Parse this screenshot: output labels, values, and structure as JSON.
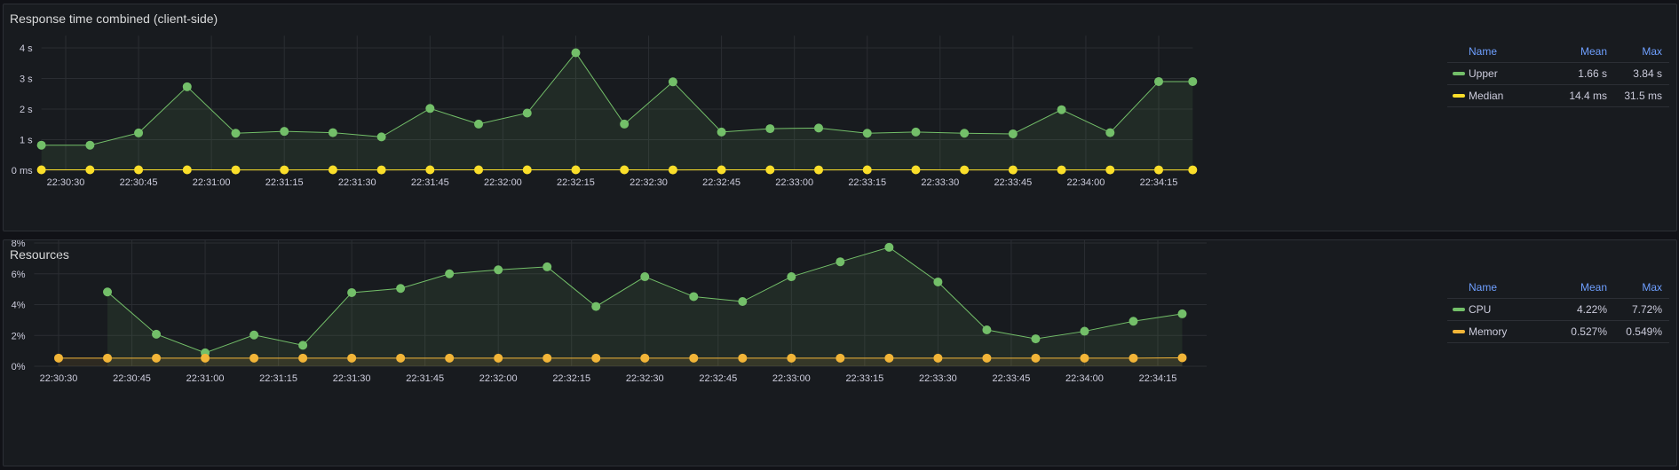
{
  "panels": [
    {
      "title": "Response time combined (client-side)",
      "legend": {
        "headers": {
          "name": "Name",
          "mean": "Mean",
          "max": "Max"
        },
        "rows": [
          {
            "name": "Upper",
            "mean": "1.66 s",
            "max": "3.84 s",
            "color": "#73bf69"
          },
          {
            "name": "Median",
            "mean": "14.4 ms",
            "max": "31.5 ms",
            "color": "#fade2a"
          }
        ]
      }
    },
    {
      "title": "Resources",
      "legend": {
        "headers": {
          "name": "Name",
          "mean": "Mean",
          "max": "Max"
        },
        "rows": [
          {
            "name": "CPU",
            "mean": "4.22%",
            "max": "7.72%",
            "color": "#73bf69"
          },
          {
            "name": "Memory",
            "mean": "0.527%",
            "max": "0.549%",
            "color": "#f2b538"
          }
        ]
      }
    }
  ],
  "chart_data": [
    {
      "type": "line",
      "title": "Response time combined (client-side)",
      "y_unit": "s",
      "ylim": [
        0,
        4.4
      ],
      "y_ticks": [
        0,
        1,
        2,
        3,
        4
      ],
      "y_tick_labels": [
        "0 ms",
        "1 s",
        "2 s",
        "3 s",
        "4 s"
      ],
      "x_range": [
        "22:30:25",
        "22:34:22"
      ],
      "x_ticks": [
        "22:30:30",
        "22:30:45",
        "22:31:00",
        "22:31:15",
        "22:31:30",
        "22:31:45",
        "22:32:00",
        "22:32:15",
        "22:32:30",
        "22:32:45",
        "22:33:00",
        "22:33:15",
        "22:33:30",
        "22:33:45",
        "22:34:00",
        "22:34:15"
      ],
      "grid": true,
      "fill": true,
      "legend_placement": "right",
      "series": [
        {
          "name": "Upper",
          "color": "#73bf69",
          "x": [
            "22:30:25",
            "22:30:35",
            "22:30:45",
            "22:30:55",
            "22:31:05",
            "22:31:15",
            "22:31:25",
            "22:31:35",
            "22:31:45",
            "22:31:55",
            "22:32:05",
            "22:32:15",
            "22:32:25",
            "22:32:35",
            "22:32:45",
            "22:32:55",
            "22:33:05",
            "22:33:15",
            "22:33:25",
            "22:33:35",
            "22:33:45",
            "22:33:55",
            "22:34:05",
            "22:34:15",
            "22:34:22"
          ],
          "values": [
            0.82,
            0.82,
            1.22,
            2.73,
            1.21,
            1.27,
            1.23,
            1.09,
            2.02,
            1.51,
            1.87,
            3.84,
            1.51,
            2.89,
            1.25,
            1.36,
            1.38,
            1.21,
            1.25,
            1.21,
            1.19,
            1.98,
            1.23,
            2.9,
            2.9
          ]
        },
        {
          "name": "Median",
          "color": "#fade2a",
          "x": [
            "22:30:25",
            "22:30:35",
            "22:30:45",
            "22:30:55",
            "22:31:05",
            "22:31:15",
            "22:31:25",
            "22:31:35",
            "22:31:45",
            "22:31:55",
            "22:32:05",
            "22:32:15",
            "22:32:25",
            "22:32:35",
            "22:32:45",
            "22:32:55",
            "22:33:05",
            "22:33:15",
            "22:33:25",
            "22:33:35",
            "22:33:45",
            "22:33:55",
            "22:34:05",
            "22:34:15",
            "22:34:22"
          ],
          "values": [
            0.015,
            0.015,
            0.015,
            0.015,
            0.012,
            0.012,
            0.015,
            0.012,
            0.015,
            0.015,
            0.015,
            0.015,
            0.015,
            0.012,
            0.015,
            0.015,
            0.012,
            0.015,
            0.015,
            0.012,
            0.012,
            0.012,
            0.012,
            0.012,
            0.012
          ]
        }
      ]
    },
    {
      "type": "line",
      "title": "Resources",
      "y_unit": "%",
      "ylim": [
        0,
        8.6
      ],
      "y_ticks": [
        0,
        2,
        4,
        6,
        8
      ],
      "y_tick_labels": [
        "0%",
        "2%",
        "4%",
        "6%",
        "8%"
      ],
      "x_range": [
        "22:30:25",
        "22:34:25"
      ],
      "x_ticks": [
        "22:30:30",
        "22:30:45",
        "22:31:00",
        "22:31:15",
        "22:31:30",
        "22:31:45",
        "22:32:00",
        "22:32:15",
        "22:32:30",
        "22:32:45",
        "22:33:00",
        "22:33:15",
        "22:33:30",
        "22:33:45",
        "22:34:00",
        "22:34:15"
      ],
      "grid": true,
      "fill": true,
      "legend_placement": "right",
      "series": [
        {
          "name": "CPU",
          "color": "#73bf69",
          "x": [
            "22:30:40",
            "22:30:50",
            "22:31:00",
            "22:31:10",
            "22:31:20",
            "22:31:30",
            "22:31:40",
            "22:31:50",
            "22:32:00",
            "22:32:10",
            "22:32:20",
            "22:32:30",
            "22:32:40",
            "22:32:50",
            "22:33:00",
            "22:33:10",
            "22:33:20",
            "22:33:30",
            "22:33:40",
            "22:33:50",
            "22:34:00",
            "22:34:10",
            "22:34:20"
          ],
          "values": [
            4.82,
            2.08,
            0.87,
            2.03,
            1.36,
            4.78,
            5.05,
            6.0,
            6.26,
            6.45,
            3.88,
            5.81,
            4.52,
            4.2,
            5.81,
            6.78,
            7.72,
            5.47,
            2.36,
            1.78,
            2.27,
            2.92,
            3.4
          ]
        },
        {
          "name": "Memory",
          "color": "#f2b538",
          "x": [
            "22:30:30",
            "22:30:40",
            "22:30:50",
            "22:31:00",
            "22:31:10",
            "22:31:20",
            "22:31:30",
            "22:31:40",
            "22:31:50",
            "22:32:00",
            "22:32:10",
            "22:32:20",
            "22:32:30",
            "22:32:40",
            "22:32:50",
            "22:33:00",
            "22:33:10",
            "22:33:20",
            "22:33:30",
            "22:33:40",
            "22:33:50",
            "22:34:00",
            "22:34:10",
            "22:34:20"
          ],
          "values": [
            0.527,
            0.527,
            0.527,
            0.527,
            0.527,
            0.527,
            0.527,
            0.527,
            0.527,
            0.527,
            0.527,
            0.527,
            0.527,
            0.527,
            0.527,
            0.527,
            0.527,
            0.527,
            0.527,
            0.527,
            0.527,
            0.527,
            0.527,
            0.549
          ]
        }
      ]
    }
  ]
}
